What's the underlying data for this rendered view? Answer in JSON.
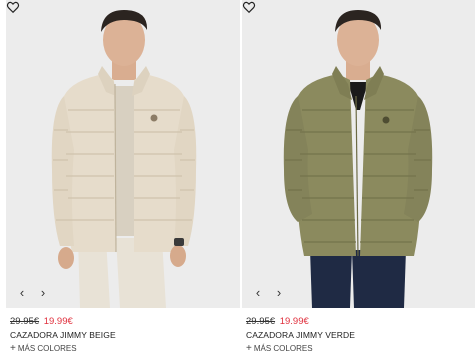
{
  "products": [
    {
      "old_price": "29.95€",
      "new_price": "19.99€",
      "name": "CAZADORA JIMMY BEIGE",
      "more_colors": "MÁS COLORES",
      "jacket_color": "#e6dccb",
      "icons": {
        "wishlist": "heart-outline-icon",
        "prev": "chevron-left-icon",
        "next": "chevron-right-icon",
        "more": "plus-icon"
      }
    },
    {
      "old_price": "29.95€",
      "new_price": "19.99€",
      "name": "CAZADORA JIMMY VERDE",
      "more_colors": "MÁS COLORES",
      "jacket_color": "#8b8a5e",
      "icons": {
        "wishlist": "heart-outline-icon",
        "prev": "chevron-left-icon",
        "next": "chevron-right-icon",
        "more": "plus-icon"
      }
    }
  ],
  "colors": {
    "sale_price": "#e0303d",
    "photo_bg": "#ececec"
  }
}
